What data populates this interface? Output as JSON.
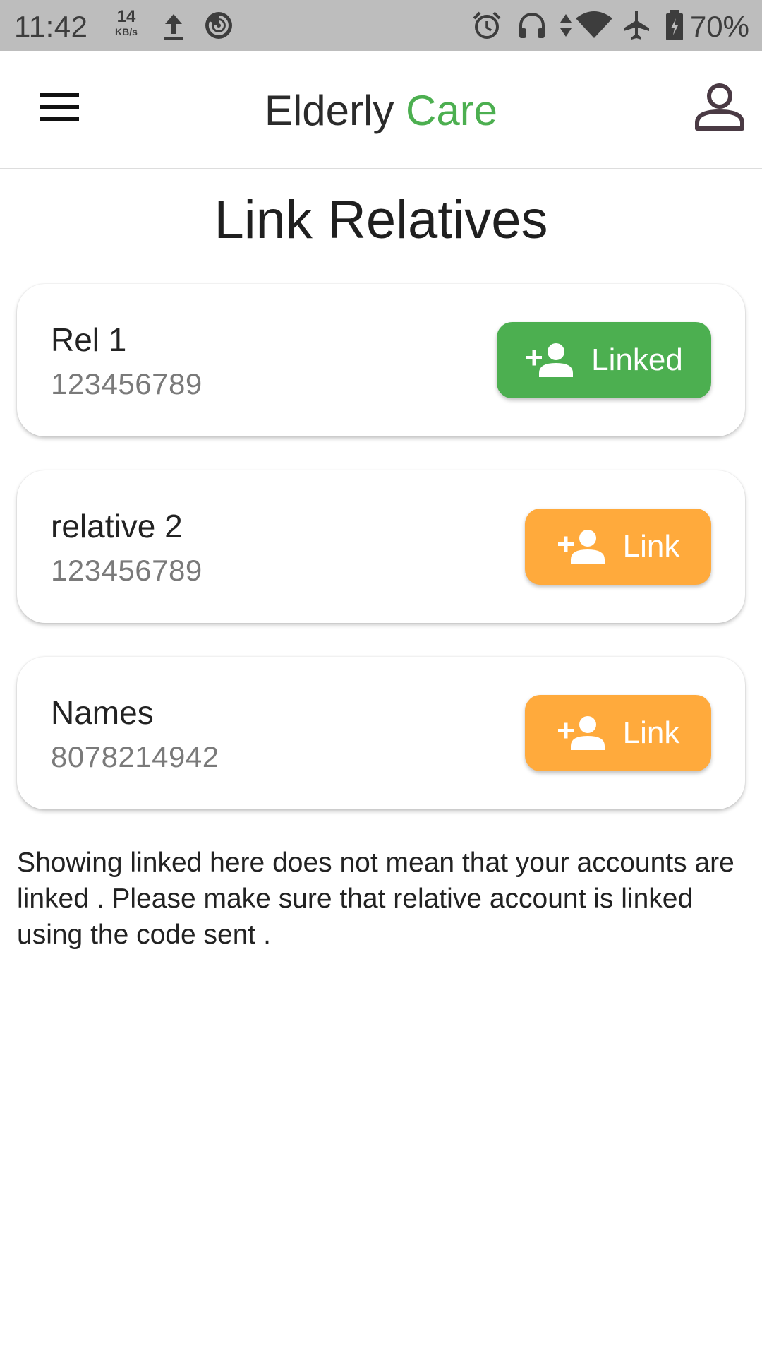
{
  "status_bar": {
    "time": "11:42",
    "net_speed_value": "14",
    "net_speed_unit": "KB/s",
    "battery_percent": "70%",
    "icons": [
      "upload-icon",
      "sync-icon",
      "alarm-icon",
      "headset-icon",
      "data-arrows-icon",
      "wifi-icon",
      "airplane-icon",
      "battery-icon"
    ]
  },
  "app_bar": {
    "title_part1": "Elderly",
    "title_part2": "Care",
    "accent_color": "#4caf50"
  },
  "page": {
    "title": "Link Relatives"
  },
  "relatives": [
    {
      "name": "Rel 1",
      "phone": "123456789",
      "button_label": "Linked",
      "status": "linked",
      "color": "#4caf50"
    },
    {
      "name": "relative 2",
      "phone": "123456789",
      "button_label": "Link",
      "status": "unlinked",
      "color": "#ffaa3c"
    },
    {
      "name": "Names",
      "phone": "8078214942",
      "button_label": "Link",
      "status": "unlinked",
      "color": "#ffaa3c"
    }
  ],
  "note": "Showing linked here does not mean that your accounts are linked . Please make sure that relative account is linked using the code sent ."
}
